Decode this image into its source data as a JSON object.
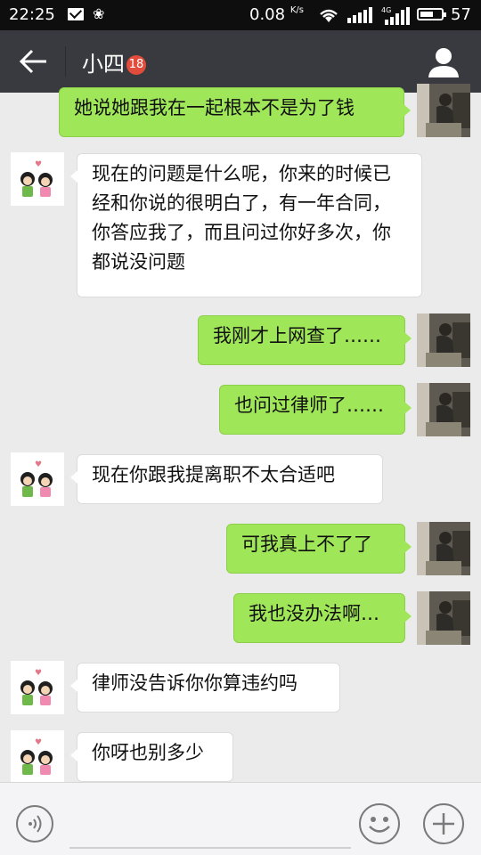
{
  "status": {
    "time": "22:25",
    "speed": "0.08",
    "speed_unit": "K/s",
    "network": "4G",
    "battery": "57"
  },
  "header": {
    "title": "小四",
    "badge": "18"
  },
  "messages": [
    {
      "side": "out",
      "text": "她说她跟我在一起根本不是为了钱"
    },
    {
      "side": "in",
      "text": "现在的问题是什么呢，你来的时候已经和你说的很明白了，有一年合同，你答应我了，而且问过你好多次，你都说没问题"
    },
    {
      "side": "out",
      "text": "我刚才上网查了……"
    },
    {
      "side": "out",
      "text": "也问过律师了……"
    },
    {
      "side": "in",
      "text": "现在你跟我提离职不太合适吧"
    },
    {
      "side": "out",
      "text": "可我真上不了了"
    },
    {
      "side": "out",
      "text": "我也没办法啊…"
    },
    {
      "side": "in",
      "text": "律师没告诉你你算违约吗"
    },
    {
      "side": "in",
      "text": "你呀也别多少"
    }
  ],
  "colors": {
    "out_bubble": "#9fe658",
    "in_bubble": "#ffffff",
    "title_bar": "#393a3f",
    "status_bar": "#0e0e0e",
    "background": "#ebebeb"
  },
  "icons": {
    "back": "arrow-left-icon",
    "profile": "person-icon",
    "voice": "voice-icon",
    "emoji": "smiley-icon",
    "more": "plus-icon"
  },
  "input": {
    "value": ""
  }
}
